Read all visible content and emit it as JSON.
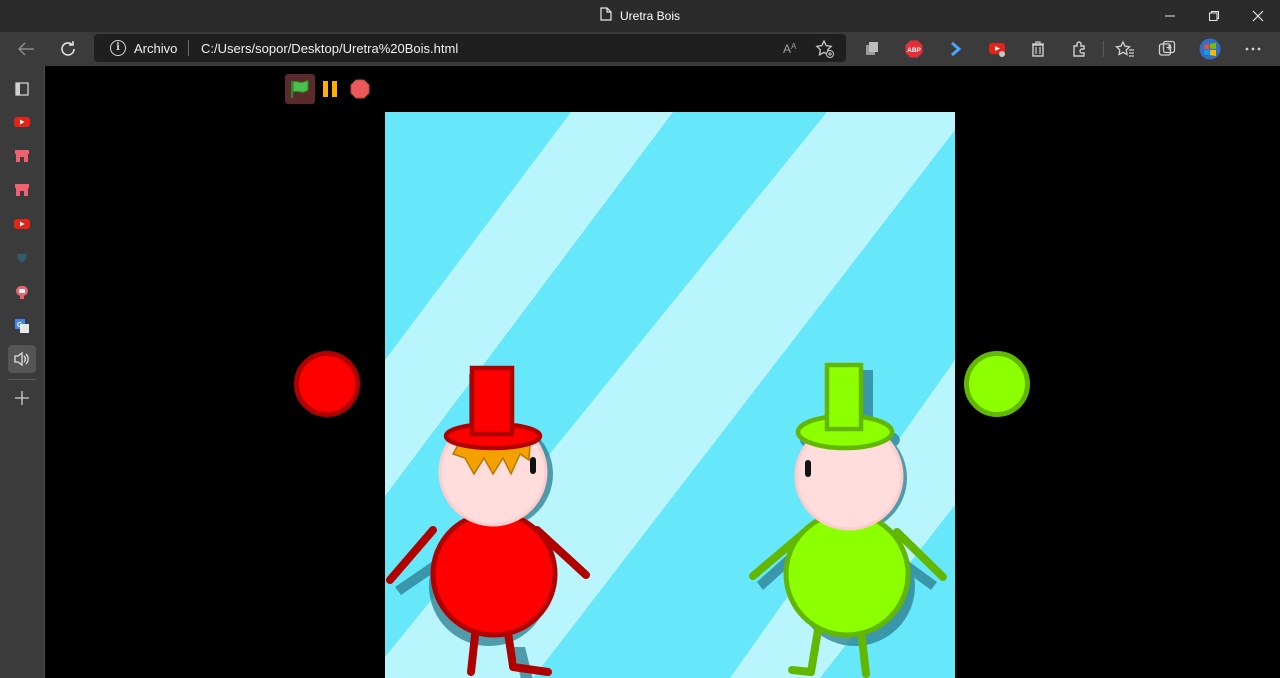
{
  "window": {
    "title": "Uretra Bois",
    "controls": [
      "minimize",
      "restore",
      "close"
    ]
  },
  "toolbar": {
    "address": {
      "scheme_label": "Archivo",
      "url": "C:/Users/sopor/Desktop/Uretra%20Bois.html"
    },
    "extensions": [
      {
        "name": "extension-copy-icon"
      },
      {
        "name": "adblock-plus-icon",
        "label": "ABP"
      },
      {
        "name": "extension-arrow-icon"
      },
      {
        "name": "youtube-extension-icon"
      },
      {
        "name": "trash-icon"
      }
    ]
  },
  "sidebar": {
    "items": [
      {
        "name": "tab-panel-icon"
      },
      {
        "name": "youtube-tab-icon"
      },
      {
        "name": "store-tab-icon"
      },
      {
        "name": "store-tab-icon-2"
      },
      {
        "name": "youtube-tab-icon-2"
      },
      {
        "name": "shield-tab-icon"
      },
      {
        "name": "app-tab-icon"
      },
      {
        "name": "translate-tab-icon"
      },
      {
        "name": "speaker-tab-icon",
        "active": true
      },
      {
        "name": "add-tab-icon"
      }
    ]
  },
  "game": {
    "controls": [
      "green-flag",
      "pause",
      "stop"
    ],
    "players": [
      {
        "name": "red",
        "color": "#ff0000",
        "outline": "#b00000"
      },
      {
        "name": "green",
        "color": "#8cff00",
        "outline": "#62b800"
      }
    ],
    "colors": {
      "background": "#66e8fa",
      "stripes": "#b8f5fc",
      "face": "#ffdddd",
      "hair": "#f4a000"
    }
  }
}
